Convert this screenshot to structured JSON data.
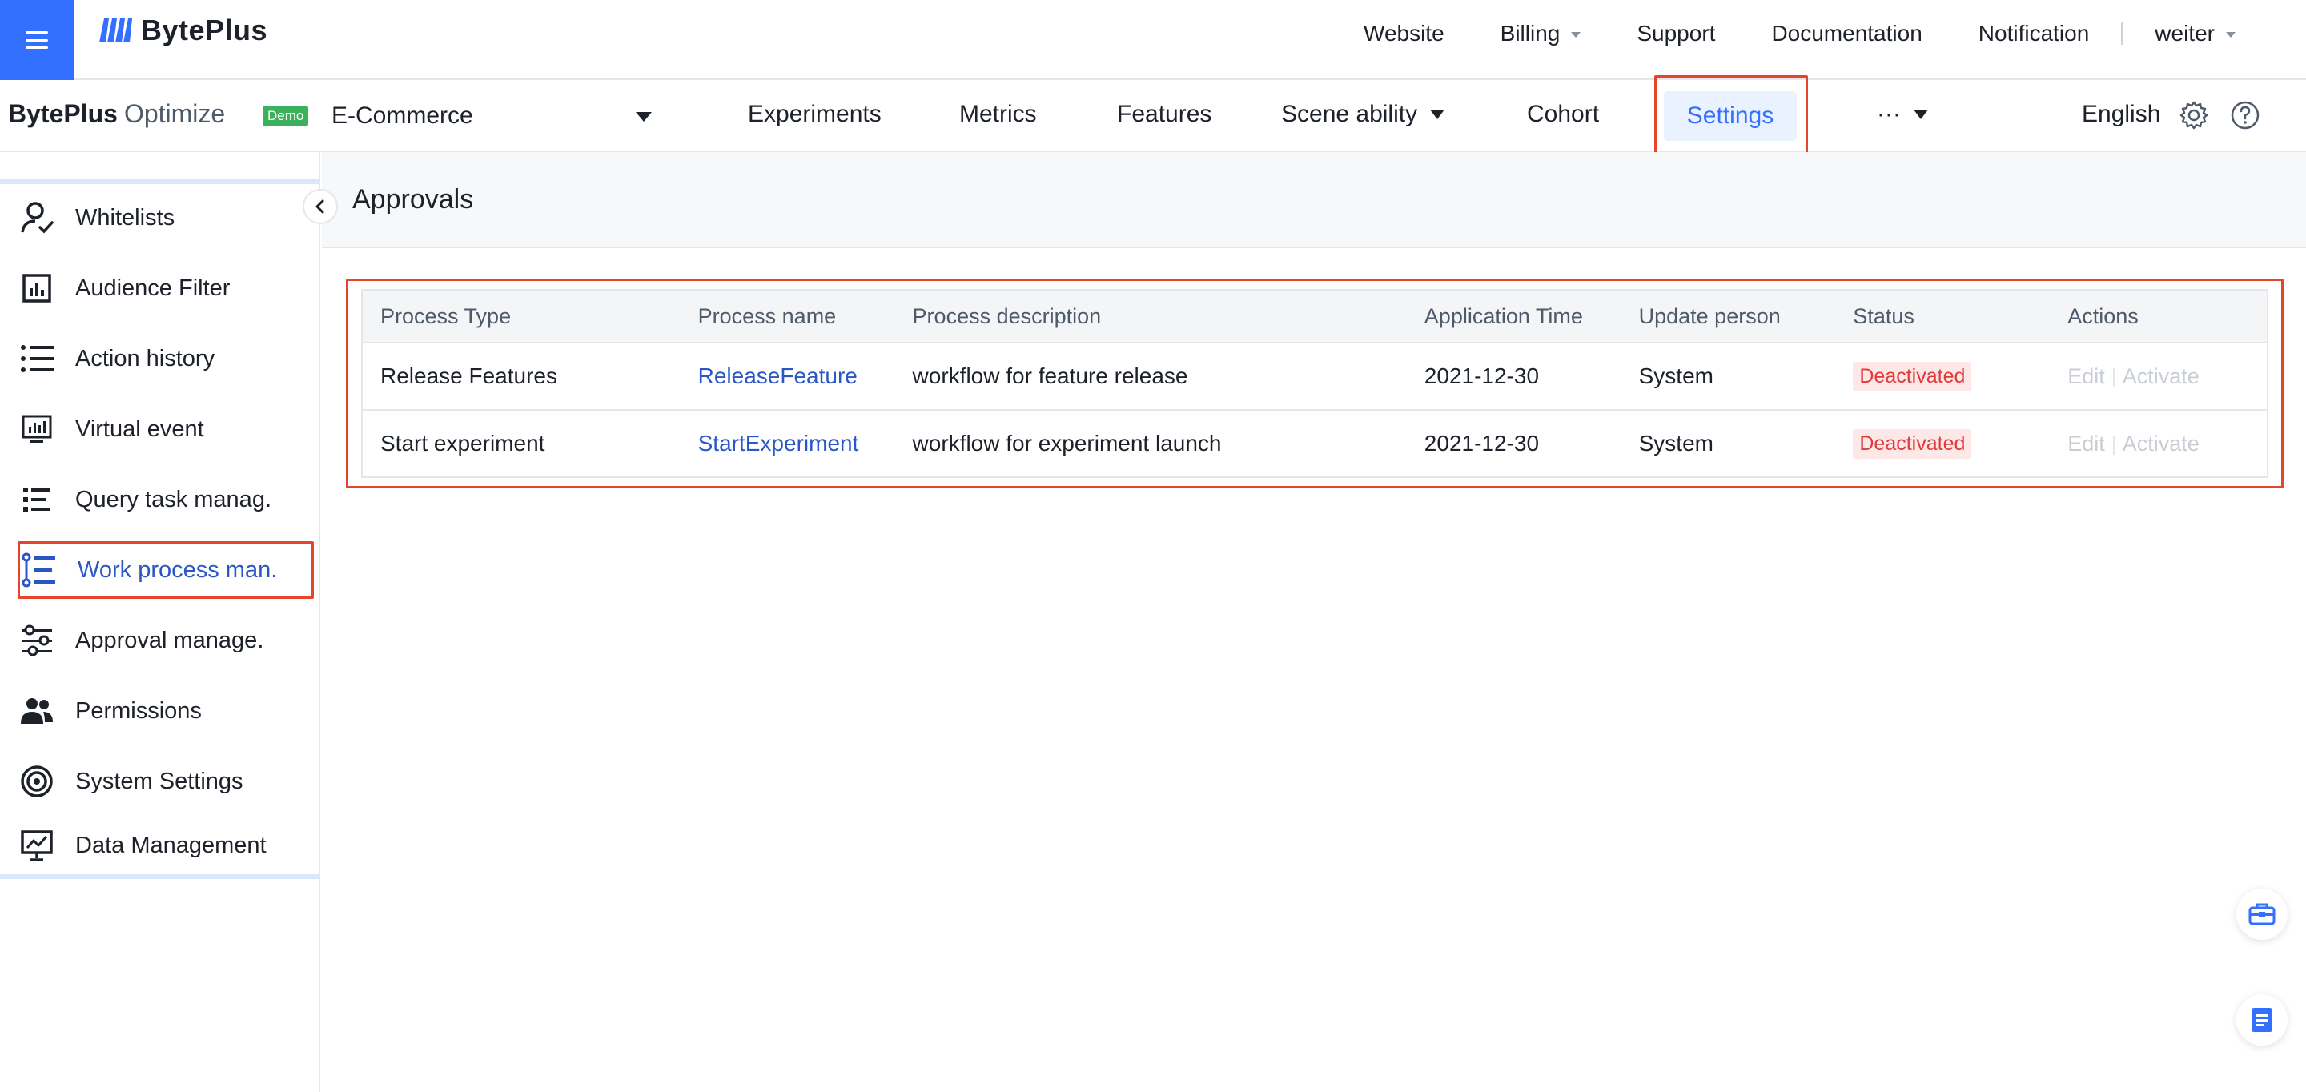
{
  "header": {
    "brand": "BytePlus",
    "nav": [
      {
        "label": "Website"
      },
      {
        "label": "Billing"
      },
      {
        "label": "Support"
      },
      {
        "label": "Documentation"
      },
      {
        "label": "Notification"
      }
    ],
    "user": "weiter"
  },
  "subheader": {
    "product_bold": "BytePlus",
    "product_light": "Optimize",
    "badge": "Demo",
    "project": "E-Commerce",
    "tabs": {
      "experiments": "Experiments",
      "metrics": "Metrics",
      "features": "Features",
      "scene": "Scene ability",
      "cohort": "Cohort",
      "settings": "Settings",
      "more": "···"
    },
    "language": "English"
  },
  "sidebar": {
    "items": [
      {
        "label": "Whitelists",
        "icon": "user-check-icon"
      },
      {
        "label": "Audience Filter",
        "icon": "chart-box-icon"
      },
      {
        "label": "Action history",
        "icon": "list-icon"
      },
      {
        "label": "Virtual event",
        "icon": "monitor-chart-icon"
      },
      {
        "label": "Query task manag.",
        "icon": "task-list-icon"
      },
      {
        "label": "Work process man.",
        "icon": "workflow-icon"
      },
      {
        "label": "Approval manage.",
        "icon": "sliders-icon"
      },
      {
        "label": "Permissions",
        "icon": "users-icon"
      },
      {
        "label": "System Settings",
        "icon": "target-icon"
      },
      {
        "label": "Data Management",
        "icon": "presentation-chart-icon"
      }
    ]
  },
  "main": {
    "title": "Approvals",
    "table": {
      "columns": [
        "Process Type",
        "Process name",
        "Process description",
        "Application Time",
        "Update person",
        "Status",
        "Actions"
      ],
      "rows": [
        {
          "type": "Release Features",
          "name": "ReleaseFeature",
          "description": "workflow for feature release",
          "time": "2021-12-30",
          "person": "System",
          "status": "Deactivated",
          "edit": "Edit",
          "activate": "Activate"
        },
        {
          "type": "Start experiment",
          "name": "StartExperiment",
          "description": "workflow for experiment launch",
          "time": "2021-12-30",
          "person": "System",
          "status": "Deactivated",
          "edit": "Edit",
          "activate": "Activate"
        }
      ]
    }
  },
  "colors": {
    "primary": "#3370ff",
    "link": "#2a56c6",
    "highlight_border": "#e6452b",
    "danger": "#e03a3a",
    "badge_green": "#3ab25c"
  }
}
